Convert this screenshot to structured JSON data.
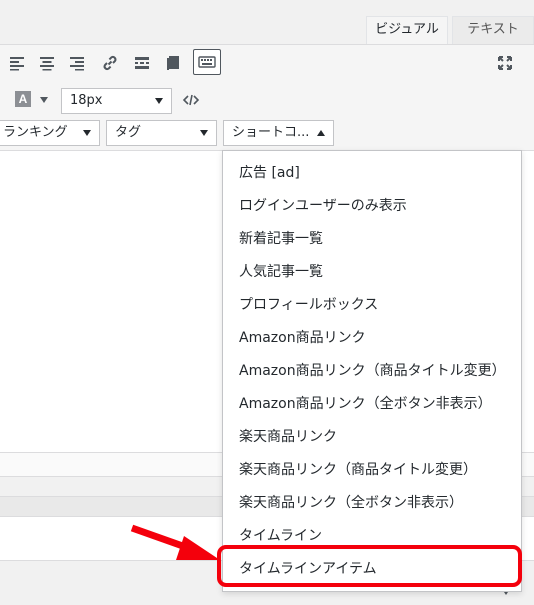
{
  "tabs": {
    "visual": "ビジュアル",
    "text": "テキスト"
  },
  "toolbar": {
    "font_size": "18px",
    "dropdowns": {
      "ranking": "ランキング",
      "tag": "タグ",
      "shortcode": "ショートコ..."
    }
  },
  "shortcode_menu": {
    "items": [
      "広告 [ad]",
      "ログインユーザーのみ表示",
      "新着記事一覧",
      "人気記事一覧",
      "プロフィールボックス",
      "Amazon商品リンク",
      "Amazon商品リンク（商品タイトル変更）",
      "Amazon商品リンク（全ボタン非表示）",
      "楽天商品リンク",
      "楽天商品リンク（商品タイトル変更）",
      "楽天商品リンク（全ボタン非表示）",
      "タイムライン",
      "タイムラインアイテム"
    ]
  },
  "annotation": {
    "highlight_color": "#f4000c"
  }
}
